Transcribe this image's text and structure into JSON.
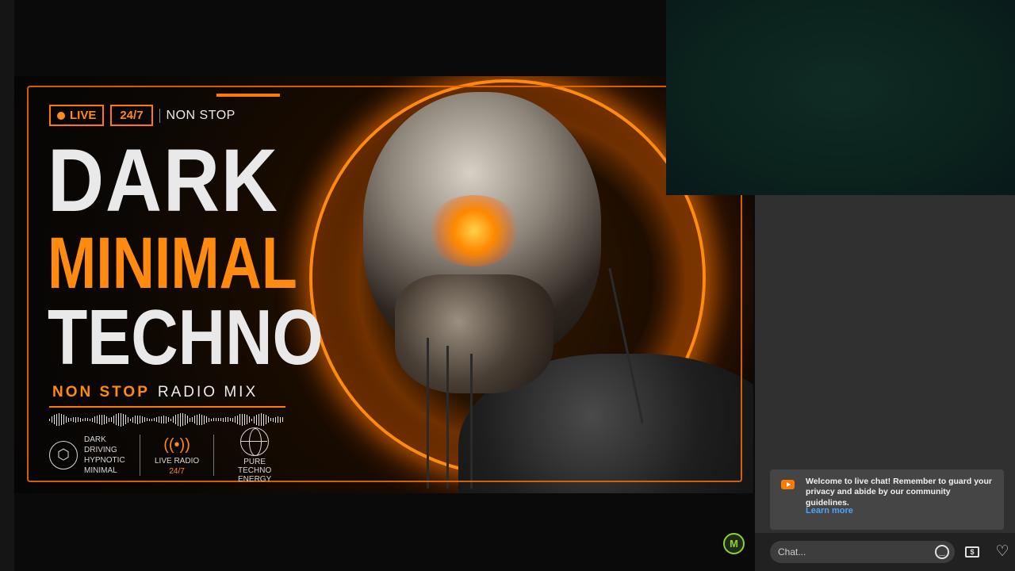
{
  "thumbnail": {
    "live_label": "LIVE",
    "always_label": "24/7",
    "nonstop_label": "NON STOP",
    "title_line1": "DARK",
    "title_line2": "MINIMAL",
    "title_line3": "TECHNO",
    "subtitle_accent": "NON STOP",
    "subtitle_rest": "RADIO MIX",
    "feature1_text": "DARK DRIVING HYPNOTIC MINIMAL",
    "feature2_label": "LIVE RADIO",
    "feature2_sub": "24/7",
    "feature3_text": "PURE TECHNO ENERGY",
    "accent_color": "#ff8a10"
  },
  "channel_badge": {
    "label": "M"
  },
  "chat": {
    "notice": "Welcome to live chat! Remember to guard your privacy and abide by our community guidelines.",
    "learn_more": "Learn more",
    "input_placeholder": "Chat...",
    "icons": [
      "emoji-icon",
      "super-chat-icon",
      "heart-icon"
    ]
  }
}
